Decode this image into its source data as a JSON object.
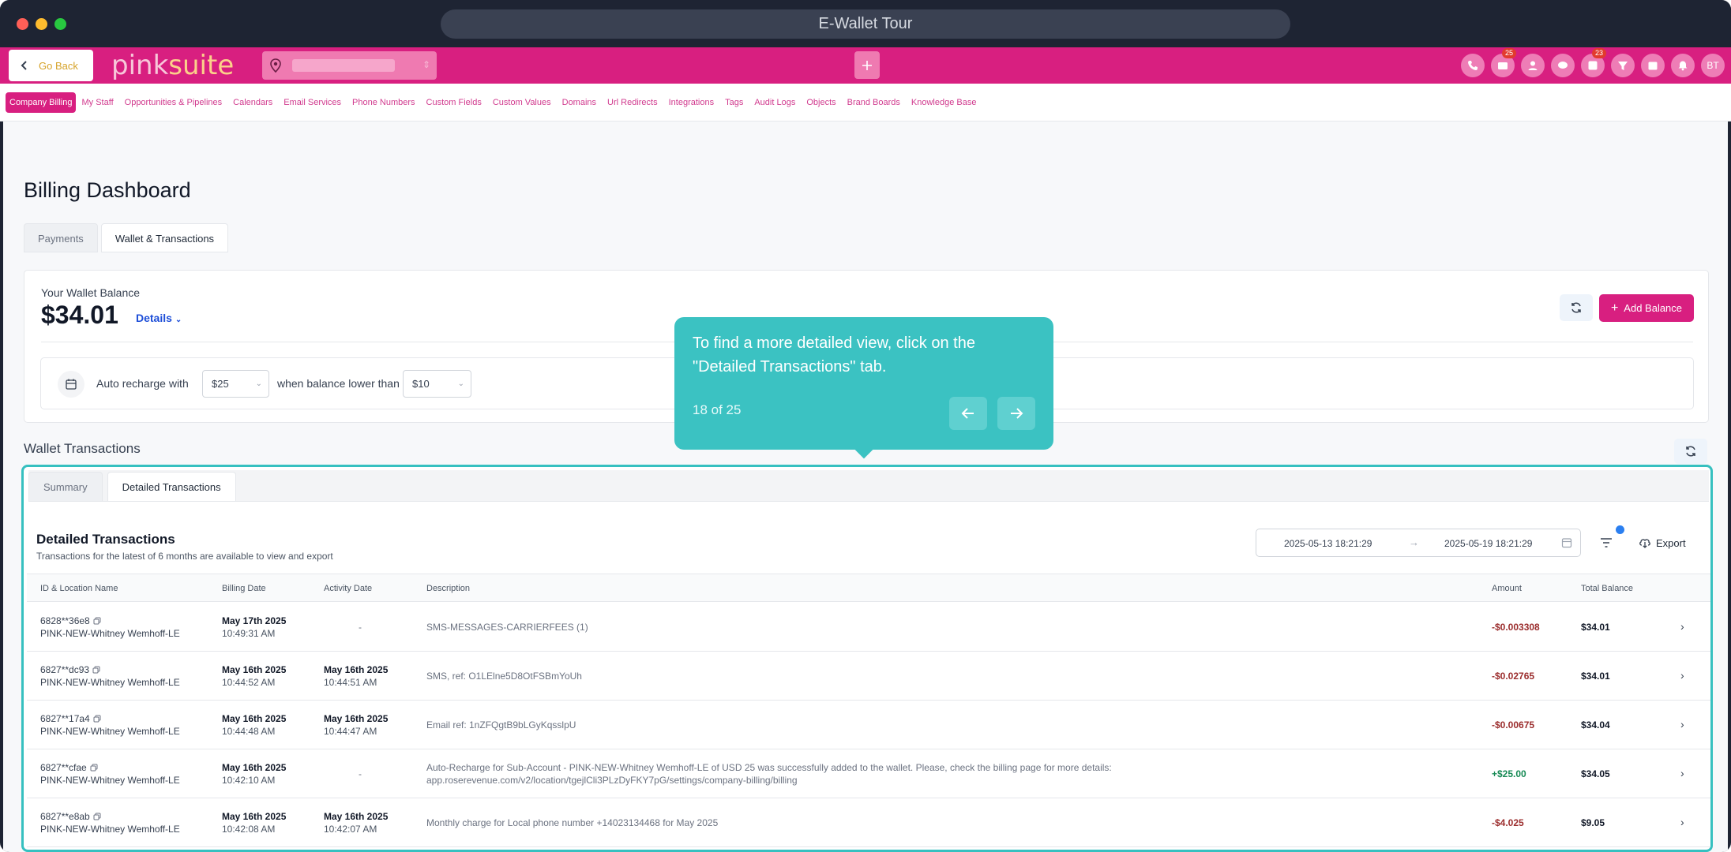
{
  "window": {
    "url_title": "E-Wallet Tour"
  },
  "header": {
    "go_back": "Go Back",
    "logo_pink": "pink",
    "logo_suite": "suite",
    "notif_badge_1": "25",
    "notif_badge_2": "23",
    "avatar_initials": "BT"
  },
  "nav": {
    "items": [
      "Company Billing",
      "My Staff",
      "Opportunities & Pipelines",
      "Calendars",
      "Email Services",
      "Phone Numbers",
      "Custom Fields",
      "Custom Values",
      "Domains",
      "Url Redirects",
      "Integrations",
      "Tags",
      "Audit Logs",
      "Objects",
      "Brand Boards",
      "Knowledge Base"
    ]
  },
  "page": {
    "title": "Billing Dashboard",
    "tabs": [
      "Payments",
      "Wallet & Transactions"
    ]
  },
  "wallet": {
    "label": "Your Wallet Balance",
    "amount": "$34.01",
    "details": "Details",
    "add_balance": "Add Balance",
    "auto_recharge_label": "Auto recharge with",
    "auto_recharge_amount": "$25",
    "threshold_label": "when balance lower than",
    "threshold_amount": "$10"
  },
  "transactions": {
    "section_title": "Wallet Transactions",
    "subtabs": [
      "Summary",
      "Detailed Transactions"
    ],
    "title": "Detailed Transactions",
    "subtitle": "Transactions for the latest of 6 months are available to view and export",
    "date_from": "2025-05-13 18:21:29",
    "date_to": "2025-05-19 18:21:29",
    "export": "Export",
    "columns": [
      "ID & Location Name",
      "Billing Date",
      "Activity Date",
      "Description",
      "Amount",
      "Total Balance"
    ],
    "rows": [
      {
        "id": "6828**36e8",
        "location": "PINK-NEW-Whitney Wemhoff-LE",
        "billing_date": "May 17th 2025",
        "billing_time": "10:49:31 AM",
        "activity_date": "",
        "activity_time": "",
        "activity_dash": "-",
        "desc1": "SMS-MESSAGES-CARRIERFEES (1)",
        "desc2": "",
        "amount": "-$0.003308",
        "balance": "$34.01",
        "sign": "neg"
      },
      {
        "id": "6827**dc93",
        "location": "PINK-NEW-Whitney Wemhoff-LE",
        "billing_date": "May 16th 2025",
        "billing_time": "10:44:52 AM",
        "activity_date": "May 16th 2025",
        "activity_time": "10:44:51 AM",
        "activity_dash": "",
        "desc1": "SMS, ref: O1LElne5D8OtFSBmYoUh",
        "desc2": "",
        "amount": "-$0.02765",
        "balance": "$34.01",
        "sign": "neg"
      },
      {
        "id": "6827**17a4",
        "location": "PINK-NEW-Whitney Wemhoff-LE",
        "billing_date": "May 16th 2025",
        "billing_time": "10:44:48 AM",
        "activity_date": "May 16th 2025",
        "activity_time": "10:44:47 AM",
        "activity_dash": "",
        "desc1": "Email ref: 1nZFQgtB9bLGyKqsslpU",
        "desc2": "",
        "amount": "-$0.00675",
        "balance": "$34.04",
        "sign": "neg"
      },
      {
        "id": "6827**cfae",
        "location": "PINK-NEW-Whitney Wemhoff-LE",
        "billing_date": "May 16th 2025",
        "billing_time": "10:42:10 AM",
        "activity_date": "",
        "activity_time": "",
        "activity_dash": "-",
        "desc1": "Auto-Recharge for Sub-Account - PINK-NEW-Whitney Wemhoff-LE of USD 25 was successfully added to the wallet. Please, check the billing page for more details:",
        "desc2": "app.roserevenue.com/v2/location/tgejlCli3PLzDyFKY7pG/settings/company-billing/billing",
        "amount": "+$25.00",
        "balance": "$34.05",
        "sign": "pos"
      },
      {
        "id": "6827**e8ab",
        "location": "PINK-NEW-Whitney Wemhoff-LE",
        "billing_date": "May 16th 2025",
        "billing_time": "10:42:08 AM",
        "activity_date": "May 16th 2025",
        "activity_time": "10:42:07 AM",
        "activity_dash": "",
        "desc1": "Monthly charge for Local phone number +14023134468 for May 2025",
        "desc2": "",
        "amount": "-$4.025",
        "balance": "$9.05",
        "sign": "neg"
      }
    ]
  },
  "tour": {
    "text": "To find a more detailed view, click on the \"Detailed Transactions\" tab.",
    "step": "18 of 25"
  },
  "colors": {
    "brand": "#d81f80",
    "tour": "#3bc2c2",
    "negative": "#9b2d2d",
    "positive": "#178a55"
  }
}
